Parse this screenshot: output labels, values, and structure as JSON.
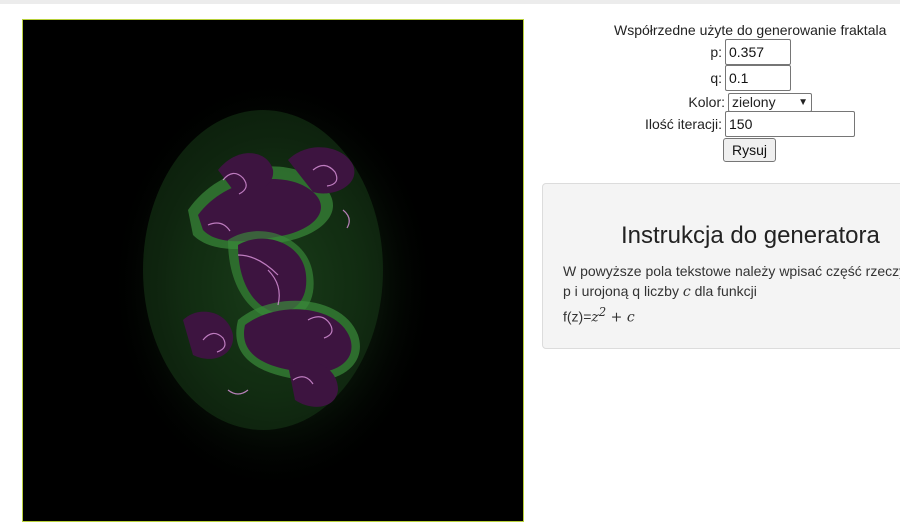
{
  "form": {
    "title": "Współrzedne użyte do generowanie fraktala",
    "p_label": "p:",
    "p_value": "0.357",
    "q_label": "q:",
    "q_value": "0.1",
    "color_label": "Kolor:",
    "color_selected": "zielony",
    "iterations_label": "Ilość iteracji:",
    "iterations_value": "150",
    "draw_button": "Rysuj"
  },
  "instructions": {
    "title": "Instrukcja do generatora",
    "line1": "W powyższe pola tekstowe należy wpisać część rzeczy",
    "line2_prefix": "p i urojoną q liczby ",
    "line2_var": "c",
    "line2_suffix": " dla funkcji",
    "formula_prefix": "f(z)=",
    "formula_base": "z",
    "formula_exp": "2",
    "formula_rest": " + c"
  },
  "canvas": {
    "background": "#000000",
    "glow_color": "#2a6a2a",
    "edge_color": "#3b8a3b",
    "fill_color": "#3d1440",
    "highlight_color": "#d58fd6"
  }
}
